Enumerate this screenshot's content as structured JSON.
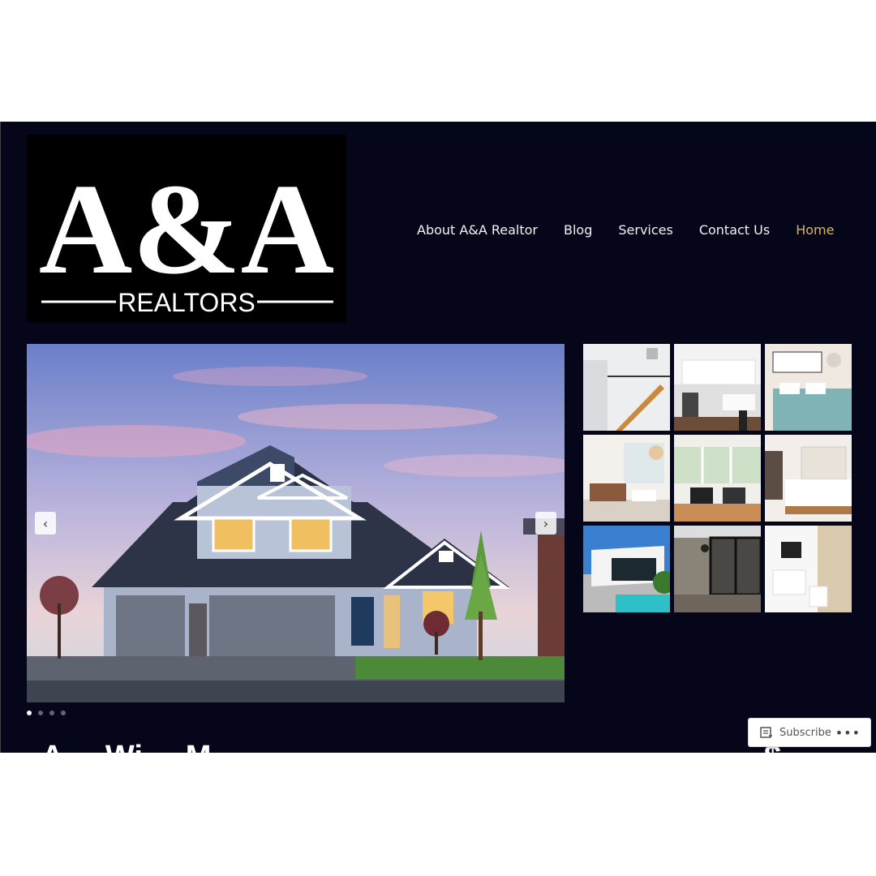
{
  "logo": {
    "main": "A&A",
    "sub": "REALTORS"
  },
  "nav": {
    "items": [
      "About A&A Realtor",
      "Blog",
      "Services",
      "Contact Us",
      "Home"
    ],
    "active_index": 4
  },
  "slider": {
    "prev_icon": "‹",
    "next_icon": "›",
    "slide_count": 4,
    "active_slide": 1
  },
  "gallery": {
    "thumbs": [
      "stairway",
      "kitchen",
      "bedroom",
      "living room",
      "lounge",
      "master bedroom",
      "pool house",
      "glass office",
      "bathroom"
    ]
  },
  "listing": {
    "title_cut": "A ... Wi ... M ...",
    "price_cut": "$... ..."
  },
  "subscribe": {
    "label": "Subscribe",
    "more": "•••"
  },
  "colors": {
    "background": "#06061a",
    "accent": "#d8b46a",
    "text": "#f2f2f2"
  }
}
